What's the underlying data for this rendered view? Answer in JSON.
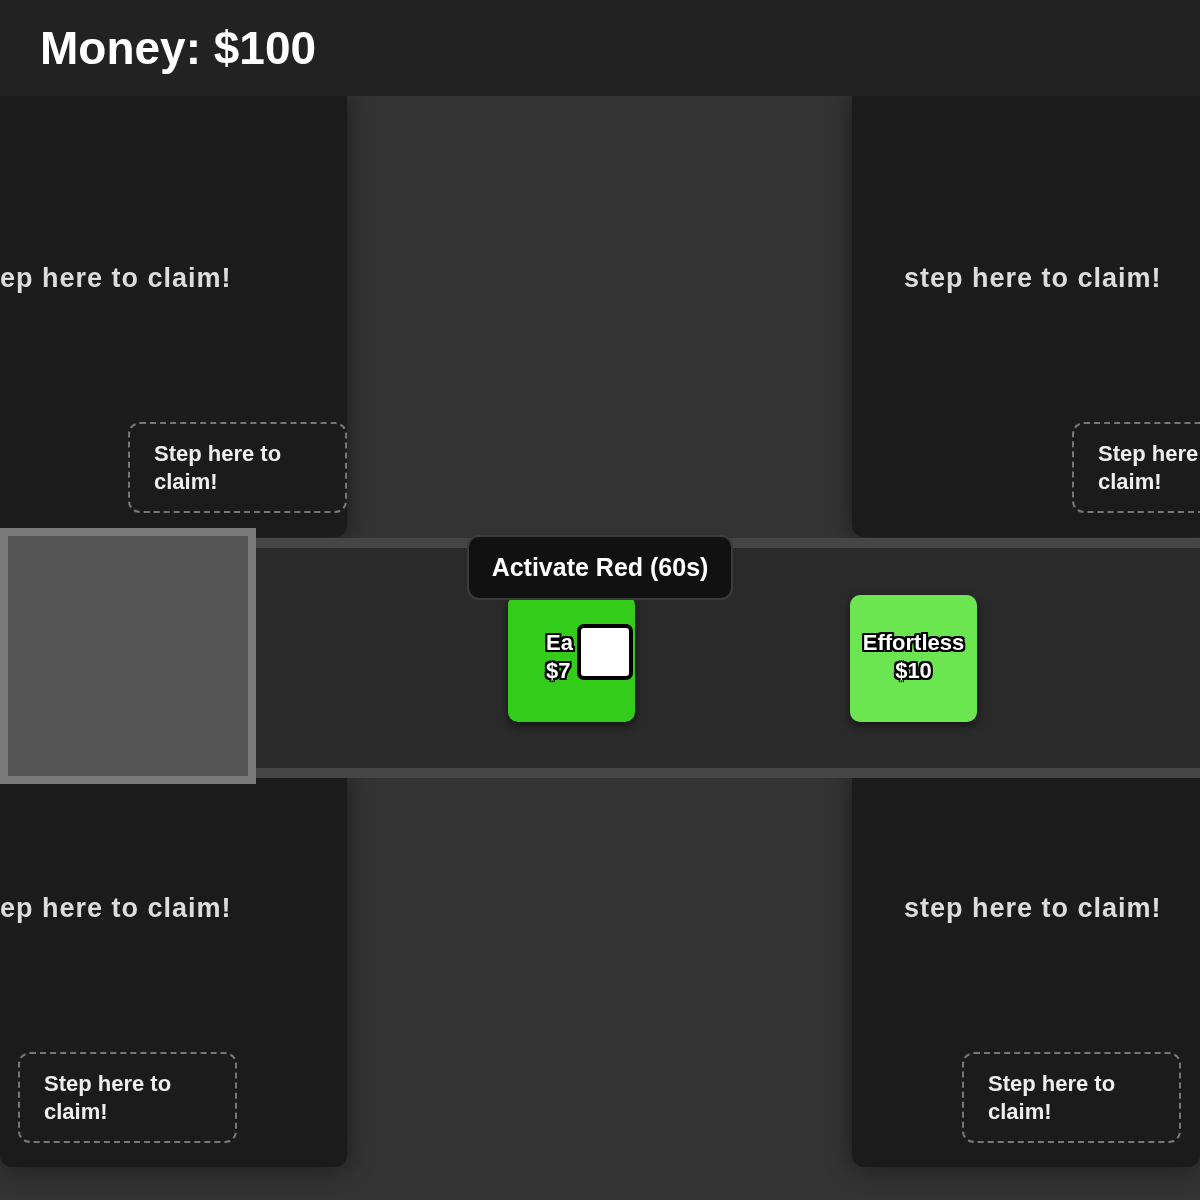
{
  "header": {
    "money": "Money: $100"
  },
  "plots": [
    {
      "title": "ep here to claim!",
      "claim": "Step here to claim!"
    },
    {
      "title": "step here to claim!",
      "claim": "Step here claim!"
    },
    {
      "title": "ep here to claim!",
      "claim": "Step here to claim!"
    },
    {
      "title": "step here to claim!",
      "claim": "Step here to claim!"
    }
  ],
  "conveyor": {
    "tooltip": "Activate Red (60s)",
    "items": [
      {
        "name": "Ea",
        "price": "$7",
        "color": "#33cc1a"
      },
      {
        "name": "Effortless",
        "price": "$10",
        "color": "#6be650"
      }
    ]
  }
}
